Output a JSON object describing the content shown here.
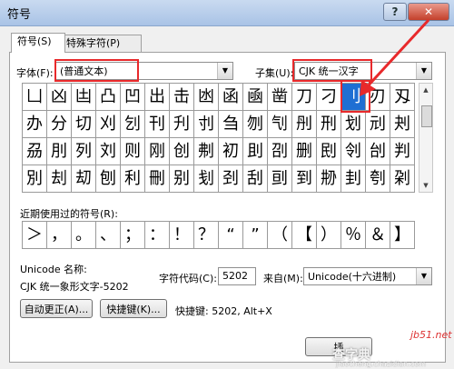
{
  "window": {
    "title": "符号",
    "help_label": "?",
    "close_label": "✕"
  },
  "tabs": [
    {
      "label": "符号(S)"
    },
    {
      "label": "特殊字符(P)"
    }
  ],
  "font": {
    "label": "字体(F):",
    "value": "(普通文本)"
  },
  "subset": {
    "label": "子集(U):",
    "value": "CJK 统一汉字"
  },
  "grid": {
    "rows": [
      [
        "凵",
        "凶",
        "凷",
        "凸",
        "凹",
        "出",
        "击",
        "凼",
        "函",
        "凾",
        "凿",
        "刀",
        "刁",
        "刂",
        "刃",
        "刄"
      ],
      [
        "办",
        "分",
        "切",
        "刈",
        "刉",
        "刊",
        "刋",
        "刌",
        "刍",
        "刎",
        "刏",
        "刐",
        "刑",
        "划",
        "刓",
        "刔"
      ],
      [
        "刕",
        "刖",
        "列",
        "刘",
        "则",
        "刚",
        "创",
        "刜",
        "初",
        "刞",
        "刟",
        "删",
        "刡",
        "刢",
        "刣",
        "判"
      ],
      [
        "別",
        "刦",
        "刧",
        "刨",
        "利",
        "刪",
        "别",
        "刬",
        "刭",
        "刮",
        "刯",
        "到",
        "刱",
        "刲",
        "刳",
        "刴"
      ]
    ],
    "selected": {
      "row": 0,
      "col": 13
    }
  },
  "recent": {
    "label": "近期使用过的符号(R):",
    "items": [
      "＞",
      "，",
      "。",
      "、",
      "；",
      "：",
      "！",
      "？",
      "“",
      "”",
      "（",
      "【",
      "）",
      "％",
      "＆",
      "】"
    ]
  },
  "unicode": {
    "label": "Unicode 名称:",
    "name": "CJK 统一象形文字-5202"
  },
  "code": {
    "label": "字符代码(C):",
    "value": "5202",
    "from_label": "来自(M):",
    "from_value": "Unicode(十六进制)"
  },
  "buttons": {
    "autocorrect": "自动更正(A)...",
    "shortcut_key": "快捷键(K)...",
    "shortcut_text": "快捷键: 5202, Alt+X",
    "insert": "插"
  },
  "watermark": {
    "site": "jb51.net",
    "brand": "查字典",
    "url": "jiaocheng.chazidian.com"
  },
  "colors": {
    "highlight": "#e8292b",
    "selection": "#1f6fd3"
  }
}
